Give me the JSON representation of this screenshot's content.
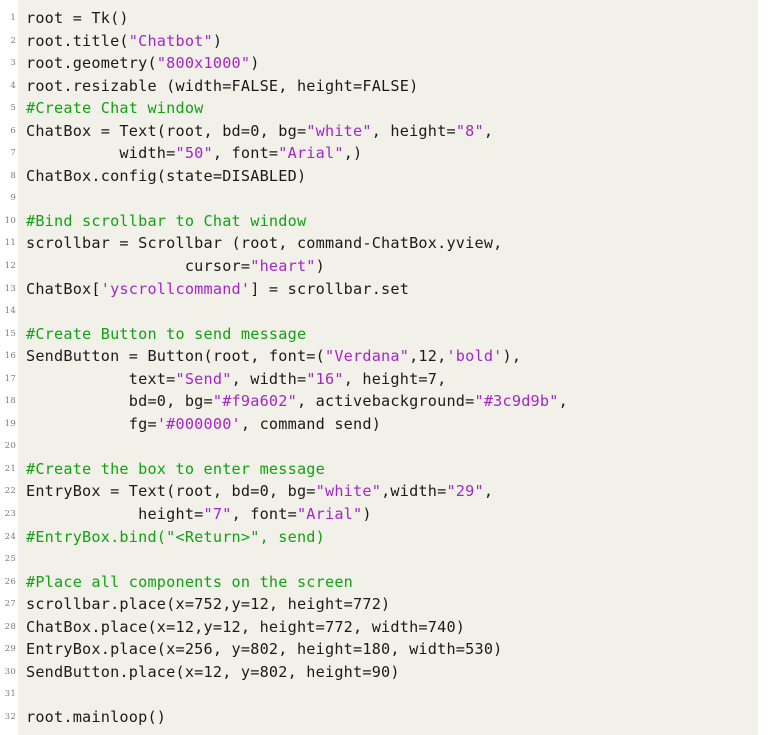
{
  "document": {
    "kind": "code-listing",
    "language": "Python",
    "theme": {
      "page_background": "#ffffff",
      "code_background": "#f1f1e9",
      "default_text": "#1a1a1a",
      "string_color": "#a626c4",
      "comment_color": "#14a014",
      "line_number_color": "#7d7d78"
    },
    "line_count": 32
  },
  "lines": [
    {
      "n": "1",
      "tokens": [
        {
          "t": "root = Tk()",
          "c": "plain"
        }
      ]
    },
    {
      "n": "2",
      "tokens": [
        {
          "t": "root.title(",
          "c": "plain"
        },
        {
          "t": "\"Chatbot\"",
          "c": "str"
        },
        {
          "t": ")",
          "c": "plain"
        }
      ]
    },
    {
      "n": "3",
      "tokens": [
        {
          "t": "root.geometry(",
          "c": "plain"
        },
        {
          "t": "\"800x1000\"",
          "c": "str"
        },
        {
          "t": ")",
          "c": "plain"
        }
      ]
    },
    {
      "n": "4",
      "tokens": [
        {
          "t": "root.resizable (width=FALSE, height=FALSE)",
          "c": "plain"
        }
      ]
    },
    {
      "n": "5",
      "tokens": [
        {
          "t": "#Create Chat window",
          "c": "cmt"
        }
      ]
    },
    {
      "n": "6",
      "tokens": [
        {
          "t": "ChatBox = Text(root, bd=0, bg=",
          "c": "plain"
        },
        {
          "t": "\"white\"",
          "c": "str"
        },
        {
          "t": ", height=",
          "c": "plain"
        },
        {
          "t": "\"8\"",
          "c": "str"
        },
        {
          "t": ",",
          "c": "plain"
        }
      ]
    },
    {
      "n": "7",
      "tokens": [
        {
          "t": "          width=",
          "c": "plain"
        },
        {
          "t": "\"50\"",
          "c": "str"
        },
        {
          "t": ", font=",
          "c": "plain"
        },
        {
          "t": "\"Arial\"",
          "c": "str"
        },
        {
          "t": ",)",
          "c": "plain"
        }
      ]
    },
    {
      "n": "8",
      "tokens": [
        {
          "t": "ChatBox.config(state=DISABLED)",
          "c": "plain"
        }
      ]
    },
    {
      "n": "9",
      "tokens": [
        {
          "t": "",
          "c": "plain"
        }
      ]
    },
    {
      "n": "10",
      "tokens": [
        {
          "t": "#Bind scrollbar to Chat window",
          "c": "cmt"
        }
      ]
    },
    {
      "n": "11",
      "tokens": [
        {
          "t": "scrollbar = Scrollbar (root, command-ChatBox.yview,",
          "c": "plain"
        }
      ]
    },
    {
      "n": "12",
      "tokens": [
        {
          "t": "                 cursor=",
          "c": "plain"
        },
        {
          "t": "\"heart\"",
          "c": "str"
        },
        {
          "t": ")",
          "c": "plain"
        }
      ]
    },
    {
      "n": "13",
      "tokens": [
        {
          "t": "ChatBox[",
          "c": "plain"
        },
        {
          "t": "'yscrollcommand'",
          "c": "str"
        },
        {
          "t": "] = scrollbar.set",
          "c": "plain"
        }
      ]
    },
    {
      "n": "14",
      "tokens": [
        {
          "t": "",
          "c": "plain"
        }
      ]
    },
    {
      "n": "15",
      "tokens": [
        {
          "t": "#Create Button to send message",
          "c": "cmt"
        }
      ]
    },
    {
      "n": "16",
      "tokens": [
        {
          "t": "SendButton = Button(root, font=(",
          "c": "plain"
        },
        {
          "t": "\"Verdana\"",
          "c": "str"
        },
        {
          "t": ",12,",
          "c": "plain"
        },
        {
          "t": "'bold'",
          "c": "str"
        },
        {
          "t": "),",
          "c": "plain"
        }
      ]
    },
    {
      "n": "17",
      "tokens": [
        {
          "t": "           text=",
          "c": "plain"
        },
        {
          "t": "\"Send\"",
          "c": "str"
        },
        {
          "t": ", width=",
          "c": "plain"
        },
        {
          "t": "\"16\"",
          "c": "str"
        },
        {
          "t": ", height=7,",
          "c": "plain"
        }
      ]
    },
    {
      "n": "18",
      "tokens": [
        {
          "t": "           bd=0, bg=",
          "c": "plain"
        },
        {
          "t": "\"#f9a602\"",
          "c": "str"
        },
        {
          "t": ", activebackground=",
          "c": "plain"
        },
        {
          "t": "\"#3c9d9b\"",
          "c": "str"
        },
        {
          "t": ",",
          "c": "plain"
        }
      ]
    },
    {
      "n": "19",
      "tokens": [
        {
          "t": "           fg=",
          "c": "plain"
        },
        {
          "t": "'#000000'",
          "c": "str"
        },
        {
          "t": ", command send)",
          "c": "plain"
        }
      ]
    },
    {
      "n": "20",
      "tokens": [
        {
          "t": "",
          "c": "plain"
        }
      ]
    },
    {
      "n": "21",
      "tokens": [
        {
          "t": "#Create the box to enter message",
          "c": "cmt"
        }
      ]
    },
    {
      "n": "22",
      "tokens": [
        {
          "t": "EntryBox = Text(root, bd=0, bg=",
          "c": "plain"
        },
        {
          "t": "\"white\"",
          "c": "str"
        },
        {
          "t": ",width=",
          "c": "plain"
        },
        {
          "t": "\"29\"",
          "c": "str"
        },
        {
          "t": ",",
          "c": "plain"
        }
      ]
    },
    {
      "n": "23",
      "tokens": [
        {
          "t": "            height=",
          "c": "plain"
        },
        {
          "t": "\"7\"",
          "c": "str"
        },
        {
          "t": ", font=",
          "c": "plain"
        },
        {
          "t": "\"Arial\"",
          "c": "str"
        },
        {
          "t": ")",
          "c": "plain"
        }
      ]
    },
    {
      "n": "24",
      "tokens": [
        {
          "t": "#EntryBox.bind(\"<Return>\", send)",
          "c": "cmt"
        }
      ]
    },
    {
      "n": "25",
      "tokens": [
        {
          "t": "",
          "c": "plain"
        }
      ]
    },
    {
      "n": "26",
      "tokens": [
        {
          "t": "#Place all components on the screen",
          "c": "cmt"
        }
      ]
    },
    {
      "n": "27",
      "tokens": [
        {
          "t": "scrollbar.place(x=752,y=12, height=772)",
          "c": "plain"
        }
      ]
    },
    {
      "n": "28",
      "tokens": [
        {
          "t": "ChatBox.place(x=12,y=12, height=772, width=740)",
          "c": "plain"
        }
      ]
    },
    {
      "n": "29",
      "tokens": [
        {
          "t": "EntryBox.place(x=256, y=802, height=180, width=530)",
          "c": "plain"
        }
      ]
    },
    {
      "n": "30",
      "tokens": [
        {
          "t": "SendButton.place(x=12, y=802, height=90)",
          "c": "plain"
        }
      ]
    },
    {
      "n": "31",
      "tokens": [
        {
          "t": "",
          "c": "plain"
        }
      ]
    },
    {
      "n": "32",
      "tokens": [
        {
          "t": "root.mainloop()",
          "c": "plain"
        }
      ]
    }
  ]
}
